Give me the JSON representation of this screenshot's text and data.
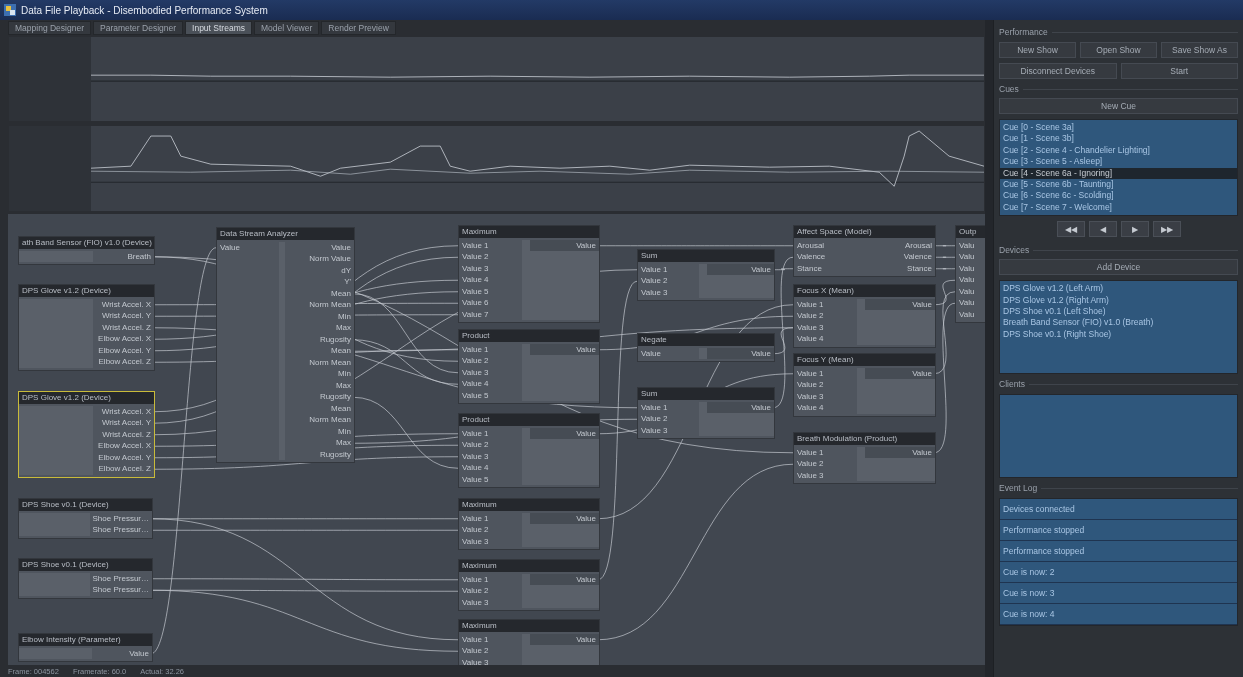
{
  "window": {
    "title": "Data File Playback - Disembodied Performance System"
  },
  "tabs": [
    {
      "label": "Mapping Designer",
      "selected": false
    },
    {
      "label": "Parameter Designer",
      "selected": false
    },
    {
      "label": "Input Streams",
      "selected": true
    },
    {
      "label": "Model Viewer",
      "selected": false
    },
    {
      "label": "Render Preview",
      "selected": false
    }
  ],
  "node_graph": {
    "nodes": [
      {
        "kind": "device",
        "title": "ath Band Sensor (FIO) v1.0 (Device)",
        "selected": false,
        "outputs": [
          "Breath"
        ]
      },
      {
        "kind": "device",
        "title": "DPS Glove v1.2 (Device)",
        "selected": false,
        "outputs": [
          "Wrist Accel. X",
          "Wrist Accel. Y",
          "Wrist Accel. Z",
          "Elbow Accel. X",
          "Elbow Accel. Y",
          "Elbow Accel. Z"
        ]
      },
      {
        "kind": "device",
        "title": "DPS Glove v1.2 (Device)",
        "selected": true,
        "outputs": [
          "Wrist Accel. X",
          "Wrist Accel. Y",
          "Wrist Accel. Z",
          "Elbow Accel. X",
          "Elbow Accel. Y",
          "Elbow Accel. Z"
        ]
      },
      {
        "kind": "analyzer",
        "title": "Data Stream Analyzer",
        "selected": false,
        "inputs": [
          "Value"
        ],
        "outputs": [
          "Value",
          "Norm Value",
          "dY",
          "Y'",
          "Mean",
          "Norm Mean",
          "Min",
          "Max",
          "Rugosity",
          "Mean",
          "Norm Mean",
          "Min",
          "Max",
          "Rugosity",
          "Mean",
          "Norm Mean",
          "Min",
          "Max",
          "Rugosity"
        ]
      },
      {
        "kind": "operator",
        "title": "Maximum",
        "selected": false,
        "inputs": [
          "Value 1",
          "Value 2",
          "Value 3",
          "Value 4",
          "Value 5",
          "Value 6",
          "Value 7"
        ],
        "outputs": [
          "Value"
        ]
      },
      {
        "kind": "operator",
        "title": "Product",
        "selected": false,
        "inputs": [
          "Value 1",
          "Value 2",
          "Value 3",
          "Value 4",
          "Value 5"
        ],
        "outputs": [
          "Value"
        ]
      },
      {
        "kind": "operator",
        "title": "Product",
        "selected": false,
        "inputs": [
          "Value 1",
          "Value 2",
          "Value 3",
          "Value 4",
          "Value 5"
        ],
        "outputs": [
          "Value"
        ]
      },
      {
        "kind": "operator",
        "title": "Maximum",
        "selected": false,
        "inputs": [
          "Value 1",
          "Value 2",
          "Value 3"
        ],
        "outputs": [
          "Value"
        ]
      },
      {
        "kind": "operator",
        "title": "Maximum",
        "selected": false,
        "inputs": [
          "Value 1",
          "Value 2",
          "Value 3"
        ],
        "outputs": [
          "Value"
        ]
      },
      {
        "kind": "operator",
        "title": "Maximum",
        "selected": false,
        "inputs": [
          "Value 1",
          "Value 2",
          "Value 3"
        ],
        "outputs": [
          "Value"
        ]
      },
      {
        "kind": "operator",
        "title": "Sum",
        "selected": false,
        "inputs": [
          "Value 1",
          "Value 2",
          "Value 3"
        ],
        "outputs": [
          "Value"
        ]
      },
      {
        "kind": "operator",
        "title": "Negate",
        "selected": false,
        "inputs": [
          "Value"
        ],
        "outputs": [
          "Value"
        ]
      },
      {
        "kind": "operator",
        "title": "Sum",
        "selected": false,
        "inputs": [
          "Value 1",
          "Value 2",
          "Value 3"
        ],
        "outputs": [
          "Value"
        ]
      },
      {
        "kind": "model",
        "title": "Affect Space (Model)",
        "selected": false,
        "inputs": [
          "Arousal",
          "Valence",
          "Stance"
        ],
        "outputs": [
          "Arousal",
          "Valence",
          "Stance"
        ]
      },
      {
        "kind": "operator",
        "title": "Focus X (Mean)",
        "selected": false,
        "inputs": [
          "Value 1",
          "Value 2",
          "Value 3",
          "Value 4"
        ],
        "outputs": [
          "Value"
        ]
      },
      {
        "kind": "operator",
        "title": "Focus Y (Mean)",
        "selected": false,
        "inputs": [
          "Value 1",
          "Value 2",
          "Value 3",
          "Value 4"
        ],
        "outputs": [
          "Value"
        ]
      },
      {
        "kind": "operator",
        "title": "Breath Modulation (Product)",
        "selected": false,
        "inputs": [
          "Value 1",
          "Value 2",
          "Value 3"
        ],
        "outputs": [
          "Value"
        ]
      },
      {
        "kind": "sink",
        "title": "Outp",
        "selected": false,
        "inputs": [
          "Valu",
          "Valu",
          "Valu",
          "Valu",
          "Valu",
          "Valu",
          "Valu"
        ]
      },
      {
        "kind": "device",
        "title": "DPS Shoe v0.1 (Device)",
        "selected": false,
        "outputs": [
          "Shoe Pressur…",
          "Shoe Pressur…"
        ]
      },
      {
        "kind": "device",
        "title": "DPS Shoe v0.1 (Device)",
        "selected": false,
        "outputs": [
          "Shoe Pressur…",
          "Shoe Pressur…"
        ]
      },
      {
        "kind": "device",
        "title": "Elbow Intensity (Parameter)",
        "selected": false,
        "outputs": [
          "Value"
        ]
      }
    ]
  },
  "status_bar": [
    "Frame: 004562",
    "Framerate: 60.0",
    "Actual: 32.26"
  ],
  "performance": {
    "title": "Performance",
    "button_rows": [
      [
        "New Show",
        "Open Show",
        "Save Show As"
      ],
      [
        "Disconnect Devices",
        "Start"
      ]
    ]
  },
  "cues": {
    "title": "Cues",
    "new_button": "New Cue",
    "items": [
      {
        "label": "Cue [0 - Scene 3a]",
        "selected": false
      },
      {
        "label": "Cue [1 - Scene 3b]",
        "selected": false
      },
      {
        "label": "Cue [2 - Scene 4 - Chandelier Lighting]",
        "selected": false
      },
      {
        "label": "Cue [3 - Scene 5 - Asleep]",
        "selected": false
      },
      {
        "label": "Cue [4 - Scene 6a - Ignoring]",
        "selected": true
      },
      {
        "label": "Cue [5 - Scene 6b - Taunting]",
        "selected": false
      },
      {
        "label": "Cue [6 - Scene 6c - Scolding]",
        "selected": false
      },
      {
        "label": "Cue [7 - Scene 7 - Welcome]",
        "selected": false
      }
    ],
    "transport": [
      "◀◀",
      "◀",
      "▶",
      "▶▶"
    ]
  },
  "devices": {
    "title": "Devices",
    "add_button": "Add Device",
    "items": [
      "DPS Glove v1.2 (Left Arm)",
      "DPS Glove v1.2 (Right Arm)",
      "DPS Shoe v0.1 (Left Shoe)",
      "Breath Band Sensor (FIO) v1.0 (Breath)",
      "DPS Shoe v0.1 (Right Shoe)"
    ]
  },
  "clients": {
    "title": "Clients"
  },
  "event_log": {
    "title": "Event Log",
    "items": [
      "Devices connected",
      "Performance stopped",
      "Performance stopped",
      "Cue is now: 2",
      "Cue is now: 3",
      "Cue is now: 4"
    ]
  }
}
